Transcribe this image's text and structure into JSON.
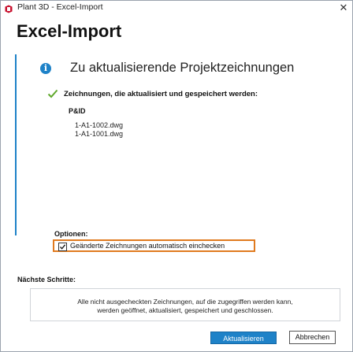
{
  "window": {
    "title": "Plant 3D - Excel-Import",
    "close_glyph": "✕",
    "app_icon": "plant3d-app-icon"
  },
  "dialog": {
    "heading": "Excel-Import",
    "section_title": "Zu aktualisierende Projektzeichnungen",
    "info_icon_glyph": "i",
    "updated_label": "Zeichnungen, die aktualisiert und gespeichert werden:",
    "group_label": "P&ID",
    "files": [
      "1-A1-1002.dwg",
      "1-A1-1001.dwg"
    ],
    "options_label": "Optionen:",
    "option_checkin": {
      "label": "Geänderte Zeichnungen automatisch einchecken",
      "checked": true
    },
    "next_steps_label": "Nächste Schritte:",
    "next_steps_line1": "Alle nicht ausgecheckten Zeichnungen, auf die zugegriffen werden kann,",
    "next_steps_line2": "werden geöffnet, aktualisiert, gespeichert und geschlossen.",
    "update_button": "Aktualisieren",
    "cancel_button": "Abbrechen"
  },
  "colors": {
    "accent": "#1e82c8",
    "check_green": "#5fa82b",
    "highlight_orange": "#e07a1f"
  }
}
